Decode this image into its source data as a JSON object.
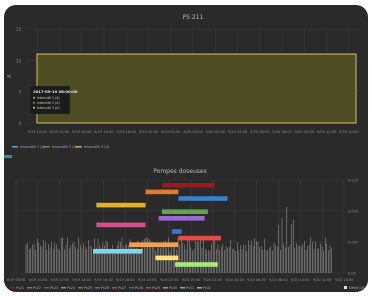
{
  "chart_data": [
    {
      "type": "area",
      "title": "PS 211",
      "ylabel": "A",
      "ylim": [
        0,
        15
      ],
      "yticks": [
        "0",
        "5",
        "10",
        "15"
      ],
      "xticks": [
        "9/19 10:00",
        "9/19 12:00",
        "9/19 14:00",
        "9/19 16:00",
        "9/19 18:00",
        "9/19 20:00",
        "9/19 22:00",
        "9/20 00:00",
        "9/20 02:00",
        "9/20 04:00",
        "9/20 06:00",
        "9/20 08:00",
        "9/20 10:00",
        "9/20 12:00",
        "9/20 14:00"
      ],
      "series": [
        {
          "name": "Intensité 1 (A)",
          "color": "#7ec8e3",
          "level": 11
        },
        {
          "name": "Intensité 2 (A)",
          "color": "#58b058",
          "level": 11
        },
        {
          "name": "Intensité 3 (A)",
          "color": "#e8c86a",
          "level": 11
        }
      ],
      "tooltip": {
        "title": "2017-09-19 08:00:00",
        "rows": [
          "Intensité 1 (A)",
          "Intensité 2 (A)",
          "Intensité 3 (A)"
        ]
      },
      "grid": true,
      "legend": "bottom-left"
    },
    {
      "type": "bar",
      "title": "Pompes doseuses",
      "y2ticks": [
        "0.00",
        "0.005",
        "0.010",
        "0.015"
      ],
      "xticks": [
        "9/19 08:00",
        "9/19 10:00",
        "9/19 12:00",
        "9/19 14:00",
        "9/19 16:00",
        "9/19 18:00",
        "9/19 20:00",
        "9/19 22:00",
        "9/20 00:00",
        "9/20 02:00",
        "9/20 04:00",
        "9/20 06:00",
        "9/20 08:00",
        "9/20 10:00",
        "9/20 12:00",
        "9/20 14:00"
      ],
      "pump_intervals": [
        {
          "color": "#9b1b1b",
          "start": 0.445,
          "end": 0.605,
          "row": 0
        },
        {
          "color": "#e07b2a",
          "start": 0.395,
          "end": 0.495,
          "row": 1
        },
        {
          "color": "#3a7fc8",
          "start": 0.495,
          "end": 0.645,
          "row": 2
        },
        {
          "color": "#e3b21a",
          "start": 0.245,
          "end": 0.395,
          "row": 3
        },
        {
          "color": "#5fa84e",
          "start": 0.445,
          "end": 0.585,
          "row": 4
        },
        {
          "color": "#9a6ad0",
          "start": 0.435,
          "end": 0.575,
          "row": 5
        },
        {
          "color": "#d4508c",
          "start": 0.245,
          "end": 0.395,
          "row": 6
        },
        {
          "color": "#2c7fd0",
          "start": 0.475,
          "end": 0.505,
          "row": 7
        },
        {
          "color": "#e84a4a",
          "start": 0.495,
          "end": 0.625,
          "row": 8
        },
        {
          "color": "#f0a050",
          "start": 0.345,
          "end": 0.495,
          "row": 9
        },
        {
          "color": "#7fd8e8",
          "start": 0.235,
          "end": 0.385,
          "row": 10
        },
        {
          "color": "#ffe070",
          "start": 0.425,
          "end": 0.495,
          "row": 11
        },
        {
          "color": "#a8e87a",
          "start": 0.485,
          "end": 0.615,
          "row": 12
        }
      ],
      "legend_entries": [
        "Ps21",
        "Ps22",
        "Ps23",
        "Ps24",
        "Ps25",
        "Ps26",
        "Ps27",
        "Ps28",
        "Ps29",
        "Ps30",
        "Ps31",
        "Ps32"
      ],
      "legend_colors": [
        "#9b1b1b",
        "#e07b2a",
        "#3a7fc8",
        "#e3b21a",
        "#5fa84e",
        "#9a6ad0",
        "#d4508c",
        "#2c7fd0",
        "#e84a4a",
        "#f0a050",
        "#7fd8e8",
        "#a8e87a"
      ],
      "extra_legend": "Débit (l/s)",
      "grid": true,
      "legend": "bottom"
    }
  ]
}
